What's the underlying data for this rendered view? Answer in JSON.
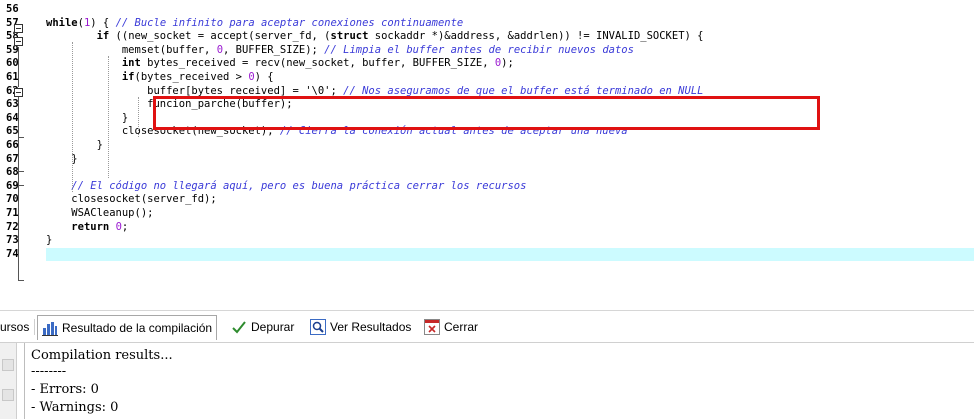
{
  "editor": {
    "lines": [
      {
        "n": "56",
        "html": ""
      },
      {
        "n": "57",
        "html": "<span class='kw'>while</span>(<span class='num'>1</span>) { <span class='cm'>// Bucle infinito para aceptar conexiones continuamente</span>"
      },
      {
        "n": "58",
        "html": "        <span class='kw'>if</span> ((new_socket = accept(server_fd, (<span class='kw'>struct</span> sockaddr *)&amp;address, &amp;addrlen)) != INVALID_SOCKET) {"
      },
      {
        "n": "59",
        "html": "            memset(buffer, <span class='num'>0</span>, BUFFER_SIZE); <span class='cm'>// Limpia el buffer antes de recibir nuevos datos</span>"
      },
      {
        "n": "60",
        "html": "            <span class='kw'>int</span> bytes_received = recv(new_socket, buffer, BUFFER_SIZE, <span class='num'>0</span>);"
      },
      {
        "n": "61",
        "html": "            <span class='kw'>if</span>(bytes_received &gt; <span class='num'>0</span>) {"
      },
      {
        "n": "62",
        "html": "                buffer[bytes_received] = <span class='str'>'\\0'</span>; <span class='cm'>// Nos aseguramos de que el buffer está terminado en NULL</span>"
      },
      {
        "n": "63",
        "html": "                funcion_parche(buffer);"
      },
      {
        "n": "64",
        "html": "            }"
      },
      {
        "n": "65",
        "html": "            closesocket(new_socket); <span class='cm'>// Cierra la conexión actual antes de aceptar una nueva</span>"
      },
      {
        "n": "66",
        "html": "        }"
      },
      {
        "n": "67",
        "html": "    }"
      },
      {
        "n": "68",
        "html": ""
      },
      {
        "n": "69",
        "html": "    <span class='cm'>// El código no llegará aquí, pero es buena práctica cerrar los recursos</span>"
      },
      {
        "n": "70",
        "html": "    closesocket(server_fd);"
      },
      {
        "n": "71",
        "html": "    WSACleanup();"
      },
      {
        "n": "72",
        "html": "    <span class='kw'>return</span> <span class='num'>0</span>;"
      },
      {
        "n": "73",
        "html": "}"
      },
      {
        "n": "74",
        "html": ""
      }
    ]
  },
  "tabs": {
    "partial": "ursos",
    "compile_results": "Resultado de la compilación",
    "debug": "Depurar",
    "view_results": "Ver Resultados",
    "close": "Cerrar"
  },
  "output": {
    "lines": [
      "Compilation results...",
      "--------",
      "- Errors: 0",
      "- Warnings: 0"
    ]
  },
  "colors": {
    "highlight": "#ccfbff",
    "annotation": "#e01212",
    "comment": "#3a3ad8",
    "number": "#9b1bd1"
  }
}
